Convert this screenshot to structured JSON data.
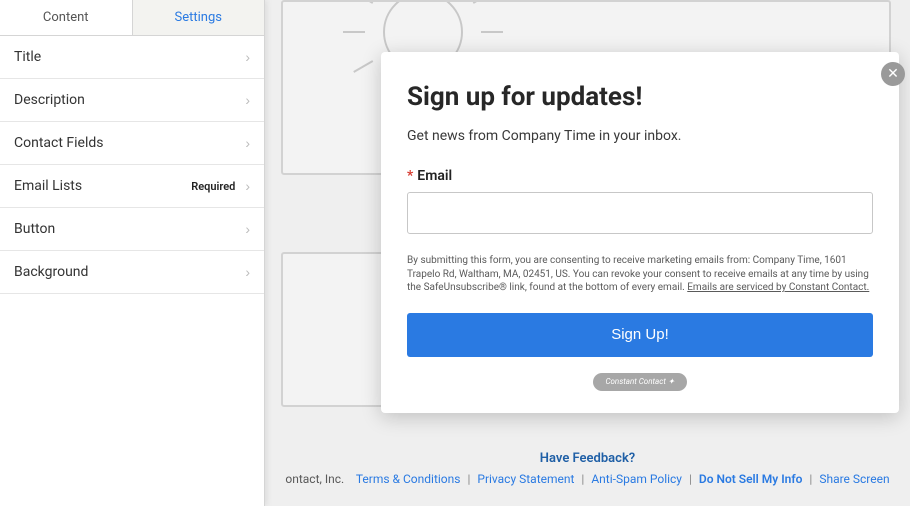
{
  "sidebar": {
    "tabs": {
      "content": "Content",
      "settings": "Settings"
    },
    "items": [
      {
        "label": "Title"
      },
      {
        "label": "Description"
      },
      {
        "label": "Contact Fields"
      },
      {
        "label": "Email Lists",
        "required": "Required"
      },
      {
        "label": "Button"
      },
      {
        "label": "Background"
      }
    ]
  },
  "modal": {
    "title": "Sign up for updates!",
    "subtitle": "Get news from Company Time in your inbox.",
    "email_label": "Email",
    "disclaimer_pre": "By submitting this form, you are consenting to receive marketing emails from: Company Time, 1601 Trapelo Rd, Waltham, MA, 02451, US. You can revoke your consent to receive emails at any time by using the SafeUnsubscribe® link, found at the bottom of every email. ",
    "disclaimer_link": "Emails are serviced by Constant Contact.",
    "button": "Sign Up!",
    "badge": "Constant Contact ✦"
  },
  "footer": {
    "feedback": "Have Feedback?",
    "copyright": "ontact, Inc.",
    "links": {
      "terms": "Terms & Conditions",
      "privacy": "Privacy Statement",
      "antispam": "Anti-Spam Policy",
      "donotsell": "Do Not Sell My Info",
      "share": "Share Screen"
    }
  }
}
